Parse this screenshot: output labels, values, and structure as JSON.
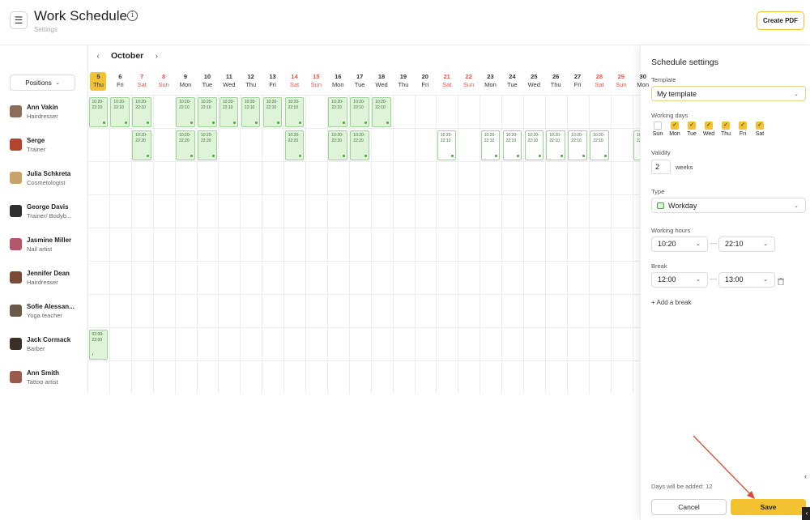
{
  "header": {
    "title": "Work Schedule",
    "breadcrumb": "Settings",
    "create_pdf_label": "Create PDF"
  },
  "filter": {
    "positions_label": "Positions"
  },
  "calendar": {
    "month": "October",
    "days": [
      {
        "num": "5",
        "dow": "Thu",
        "weekend": false,
        "today": true
      },
      {
        "num": "6",
        "dow": "Fri",
        "weekend": false
      },
      {
        "num": "7",
        "dow": "Sat",
        "weekend": true
      },
      {
        "num": "8",
        "dow": "Sun",
        "weekend": true
      },
      {
        "num": "9",
        "dow": "Mon",
        "weekend": false
      },
      {
        "num": "10",
        "dow": "Tue",
        "weekend": false
      },
      {
        "num": "11",
        "dow": "Wed",
        "weekend": false
      },
      {
        "num": "12",
        "dow": "Thu",
        "weekend": false
      },
      {
        "num": "13",
        "dow": "Fri",
        "weekend": false
      },
      {
        "num": "14",
        "dow": "Sat",
        "weekend": true
      },
      {
        "num": "15",
        "dow": "Sun",
        "weekend": true
      },
      {
        "num": "16",
        "dow": "Mon",
        "weekend": false
      },
      {
        "num": "17",
        "dow": "Tue",
        "weekend": false
      },
      {
        "num": "18",
        "dow": "Wed",
        "weekend": false
      },
      {
        "num": "19",
        "dow": "Thu",
        "weekend": false
      },
      {
        "num": "20",
        "dow": "Fri",
        "weekend": false
      },
      {
        "num": "21",
        "dow": "Sat",
        "weekend": true
      },
      {
        "num": "22",
        "dow": "Sun",
        "weekend": true
      },
      {
        "num": "23",
        "dow": "Mon",
        "weekend": false
      },
      {
        "num": "24",
        "dow": "Tue",
        "weekend": false
      },
      {
        "num": "25",
        "dow": "Wed",
        "weekend": false
      },
      {
        "num": "26",
        "dow": "Thu",
        "weekend": false
      },
      {
        "num": "27",
        "dow": "Fri",
        "weekend": false
      },
      {
        "num": "28",
        "dow": "Sat",
        "weekend": true
      },
      {
        "num": "29",
        "dow": "Sun",
        "weekend": true
      },
      {
        "num": "30",
        "dow": "Mon",
        "weekend": false
      }
    ],
    "employees": [
      {
        "name": "Ann Vakin",
        "role": "Hairdresser",
        "avatar_color": "#8a6d5a"
      },
      {
        "name": "Serge",
        "role": "Trainer",
        "avatar_color": "#b4432f"
      },
      {
        "name": "Julia Schkreta",
        "role": "Cosmetologist",
        "avatar_color": "#c9a46a"
      },
      {
        "name": "George Davis",
        "role": "Trainer/ Bodyb...",
        "avatar_color": "#2f2f2f"
      },
      {
        "name": "Jasmine Miller",
        "role": "Nail artist",
        "avatar_color": "#b3586a"
      },
      {
        "name": "Jennifer Dean",
        "role": "Hairdresser",
        "avatar_color": "#7a4a38"
      },
      {
        "name": "Sofie Alessan...",
        "role": "Yoga teacher",
        "avatar_color": "#6b5a4a"
      },
      {
        "name": "Jack Cormack",
        "role": "Barber",
        "avatar_color": "#3a3028"
      },
      {
        "name": "Ann Smith",
        "role": "Tattoo artist",
        "avatar_color": "#9a5b4e"
      }
    ],
    "shifts": [
      {
        "row": 0,
        "col": 0,
        "time": "10:20-\n22:10"
      },
      {
        "row": 0,
        "col": 1,
        "time": "10:20-\n22:10"
      },
      {
        "row": 0,
        "col": 2,
        "time": "10:20-\n22:10"
      },
      {
        "row": 0,
        "col": 4,
        "time": "10:20-\n22:10"
      },
      {
        "row": 0,
        "col": 5,
        "time": "10:20-\n22:10"
      },
      {
        "row": 0,
        "col": 6,
        "time": "10:20-\n22:10"
      },
      {
        "row": 0,
        "col": 7,
        "time": "10:20-\n22:10"
      },
      {
        "row": 0,
        "col": 8,
        "time": "10:20-\n22:10"
      },
      {
        "row": 0,
        "col": 9,
        "time": "10:20-\n22:10"
      },
      {
        "row": 0,
        "col": 11,
        "time": "10:20-\n22:10"
      },
      {
        "row": 0,
        "col": 12,
        "time": "10:20-\n22:10"
      },
      {
        "row": 0,
        "col": 13,
        "time": "10:20-\n22:10"
      },
      {
        "row": 1,
        "col": 2,
        "time": "10:20-\n22:20"
      },
      {
        "row": 1,
        "col": 4,
        "time": "10:20-\n22:20"
      },
      {
        "row": 1,
        "col": 5,
        "time": "10:20-\n22:20"
      },
      {
        "row": 1,
        "col": 9,
        "time": "10:20-\n22:20"
      },
      {
        "row": 1,
        "col": 11,
        "time": "10:20-\n22:20"
      },
      {
        "row": 1,
        "col": 12,
        "time": "10:20-\n22:20"
      },
      {
        "row": 1,
        "col": 16,
        "time": "10:20-\n22:10",
        "white": true
      },
      {
        "row": 1,
        "col": 18,
        "time": "10:20-\n22:10",
        "white": true
      },
      {
        "row": 1,
        "col": 19,
        "time": "10:20-\n22:10",
        "white": true
      },
      {
        "row": 1,
        "col": 20,
        "time": "10:20-\n22:10",
        "white": true
      },
      {
        "row": 1,
        "col": 21,
        "time": "10:20-\n22:10",
        "white": true
      },
      {
        "row": 1,
        "col": 22,
        "time": "10:20-\n22:10",
        "white": true
      },
      {
        "row": 1,
        "col": 23,
        "time": "10:20-\n22:10",
        "white": true
      },
      {
        "row": 1,
        "col": 25,
        "time": "10:20-\n22:10",
        "white": true
      },
      {
        "row": 7,
        "col": 0,
        "time": "02:00-\n22:00",
        "bar": true
      }
    ]
  },
  "panel": {
    "title": "Schedule settings",
    "template_label": "Template",
    "template_value": "My template",
    "working_days_label": "Working days",
    "working_days": [
      {
        "label": "Sun",
        "checked": false
      },
      {
        "label": "Mon",
        "checked": true
      },
      {
        "label": "Tue",
        "checked": true
      },
      {
        "label": "Wed",
        "checked": true
      },
      {
        "label": "Thu",
        "checked": true
      },
      {
        "label": "Fri",
        "checked": true
      },
      {
        "label": "Sat",
        "checked": true
      }
    ],
    "validity_label": "Validity",
    "validity_value": "2",
    "validity_unit": "weeks",
    "type_label": "Type",
    "type_value": "Workday",
    "working_hours_label": "Working hours",
    "working_hours_from": "10:20",
    "working_hours_to": "22:10",
    "break_label": "Break",
    "break_from": "12:00",
    "break_to": "13:00",
    "add_break_label": "+ Add a break",
    "days_added_text": "Days will be added: 12",
    "cancel_label": "Cancel",
    "save_label": "Save"
  },
  "colors": {
    "accent": "#f2c230",
    "weekend": "#e25c4c",
    "shift_fill": "#dff3d9",
    "shift_border": "#9fd497",
    "annotation_arrow": "#e0483a"
  }
}
